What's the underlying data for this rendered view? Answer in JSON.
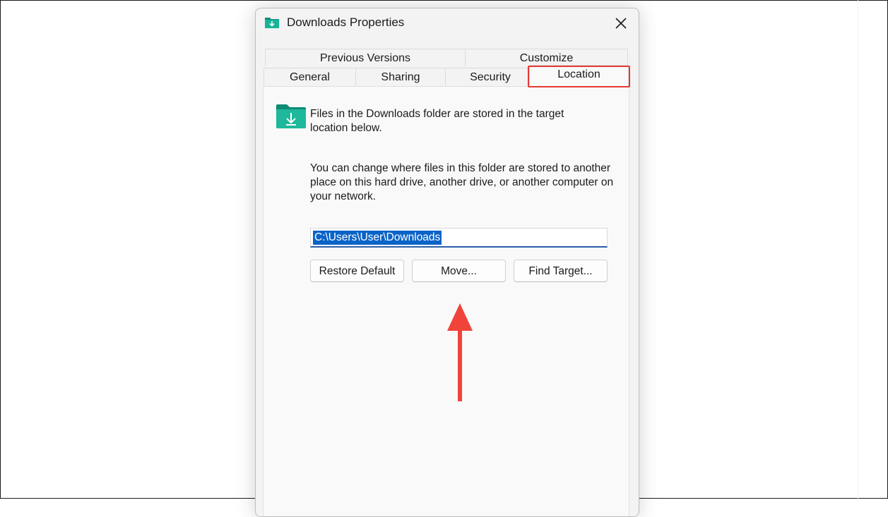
{
  "dialog": {
    "title": "Downloads Properties",
    "title_icon": "downloads-folder-icon",
    "close_icon": "close-icon"
  },
  "tabs": {
    "row1": [
      "Previous Versions",
      "Customize"
    ],
    "row2": [
      "General",
      "Sharing",
      "Security"
    ],
    "active": "Location"
  },
  "location": {
    "folder_icon": "downloads-folder-icon",
    "description": "Files in the Downloads folder are stored in the target location below.",
    "instructions": "You can change where files in this folder are stored to another place on this hard drive, another drive, or another computer on your network.",
    "path": "C:\\Users\\User\\Downloads",
    "buttons": {
      "restore_default": "Restore Default",
      "move": "Move...",
      "find_target": "Find Target..."
    }
  },
  "annotations": {
    "highlight_color": "#e53935",
    "arrow_color": "#f0443a"
  },
  "colors": {
    "folder_teal": "#14a08a",
    "selection_blue": "#0a64c8"
  }
}
